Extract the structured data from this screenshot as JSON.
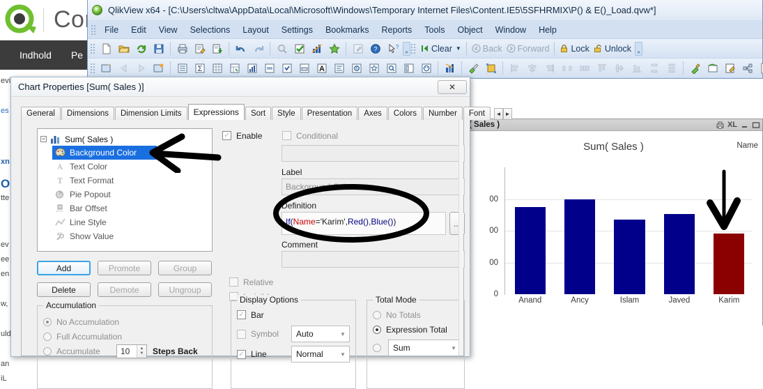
{
  "background_page": {
    "logo_icon": "qlik-q-logo",
    "brand": "Comm",
    "nav": [
      "Indhold",
      "Pe"
    ],
    "side_fragments": [
      "evi",
      "es",
      "xn",
      "O",
      "tte",
      "ev",
      "ee",
      "en",
      "w,",
      "uld",
      "an",
      "iL"
    ]
  },
  "qlikview": {
    "title": "QlikView x64 - [C:\\Users\\cltwa\\AppData\\Local\\Microsoft\\Windows\\Temporary Internet Files\\Content.IE5\\5SFHRMIX\\P() & E()_Load.qvw*]",
    "app_icon": "qlikview-globe-icon",
    "menu": [
      "File",
      "Edit",
      "View",
      "Selections",
      "Layout",
      "Settings",
      "Bookmarks",
      "Reports",
      "Tools",
      "Object",
      "Window",
      "Help"
    ],
    "toolbar1_icons": [
      "new-document-icon",
      "open-folder-icon",
      "reload-icon",
      "save-icon",
      "sep",
      "print-icon",
      "edit-script-icon",
      "load-data-icon",
      "sep",
      "undo-icon",
      "redo-icon",
      "sep",
      "search-icon",
      "select-all-icon",
      "chart-icon",
      "favorite-star-icon",
      "sep",
      "edit-module-icon",
      "help-icon",
      "context-help-icon"
    ],
    "toolbar1_buttons": [
      {
        "label": "Clear",
        "icon": "clear-icon",
        "dropdown": true,
        "enabled": true
      },
      {
        "label": "Back",
        "icon": "back-arrow-icon",
        "dropdown": false,
        "enabled": false
      },
      {
        "label": "Forward",
        "icon": "forward-arrow-icon",
        "dropdown": false,
        "enabled": false
      },
      {
        "label": "Lock",
        "icon": "lock-closed-icon",
        "dropdown": false,
        "enabled": true
      },
      {
        "label": "Unlock",
        "icon": "lock-open-icon",
        "dropdown": false,
        "enabled": true
      }
    ],
    "toolbar2_icons": [
      "new-sheet-icon",
      "previous-sheet-icon",
      "next-sheet-icon",
      "sheet-properties-icon",
      "sep",
      "list-box-icon",
      "statistics-box-icon",
      "table-box-icon",
      "pivot-table-icon",
      "chart-object-icon",
      "input-box-icon",
      "multi-box-icon",
      "current-selections-icon",
      "text-object-icon",
      "table-object-icon",
      "slider-object-icon",
      "bookmark-object-icon",
      "search-object-icon",
      "container-object-icon",
      "button-object-icon",
      "sep",
      "design-grid-icon",
      "sep",
      "paintbrush-icon",
      "fit-zoom-icon",
      "sep",
      "align-left-icon",
      "align-center-icon",
      "align-right-icon",
      "distribute-h-icon",
      "space-h-icon",
      "align-top-icon",
      "align-middle-icon",
      "align-bottom-icon",
      "distribute-v-icon",
      "space-v-icon",
      "sep",
      "promote-icon",
      "layout-icon",
      "edit-layout-icon",
      "share-icon",
      "publish-icon"
    ],
    "overflow_glyph": "»"
  },
  "chart_object": {
    "caption_title": "( Sales )",
    "caption_buttons": [
      "print-icon",
      "XL",
      "minimize-icon",
      "maximize-icon"
    ]
  },
  "chart_data": {
    "type": "bar",
    "title": "Sum( Sales )",
    "xlabel": "Name",
    "ylabel": "",
    "categories": [
      "Anand",
      "Ancy",
      "Islam",
      "Javed",
      "Karim"
    ],
    "values": [
      1370,
      1495,
      1180,
      1265,
      955
    ],
    "ylim": [
      0,
      2000
    ],
    "yticks": [
      0,
      500,
      1000,
      1500
    ],
    "ytick_labels": [
      "0",
      "00",
      "00",
      "00"
    ],
    "grid": true,
    "legend": "none",
    "bar_colors": [
      "#00008b",
      "#00008b",
      "#00008b",
      "#00008b",
      "#8b0000"
    ],
    "series": [
      {
        "name": "Sum( Sales )",
        "values": [
          1370,
          1495,
          1180,
          1265,
          955
        ]
      }
    ],
    "annotations": [
      "black down-arrow pointing at Karim bar"
    ]
  },
  "dialog": {
    "title": "Chart Properties [Sum( Sales )]",
    "close_label": "✕",
    "tabs": [
      "General",
      "Dimensions",
      "Dimension Limits",
      "Expressions",
      "Sort",
      "Style",
      "Presentation",
      "Axes",
      "Colors",
      "Number",
      "Font"
    ],
    "active_tab": "Expressions",
    "tab_scroll_left": "◄",
    "tab_scroll_right": "►",
    "tree": {
      "root": {
        "label": "Sum( Sales )",
        "icon": "bar-chart-icon",
        "expander": "−"
      },
      "items": [
        {
          "label": "Background Color",
          "icon": "palette-icon",
          "selected": true
        },
        {
          "label": "Text Color",
          "icon": "text-color-icon",
          "selected": false
        },
        {
          "label": "Text Format",
          "icon": "text-format-icon",
          "selected": false
        },
        {
          "label": "Pie Popout",
          "icon": "pie-chart-icon",
          "selected": false
        },
        {
          "label": "Bar Offset",
          "icon": "bar-offset-icon",
          "selected": false
        },
        {
          "label": "Line Style",
          "icon": "line-style-icon",
          "selected": false
        },
        {
          "label": "Show Value",
          "icon": "show-value-icon",
          "selected": false
        }
      ]
    },
    "buttons": [
      {
        "label": "Add",
        "enabled": true,
        "primary": true
      },
      {
        "label": "Promote",
        "enabled": false,
        "primary": false
      },
      {
        "label": "Group",
        "enabled": false,
        "primary": false
      },
      {
        "label": "Delete",
        "enabled": true,
        "primary": false
      },
      {
        "label": "Demote",
        "enabled": false,
        "primary": false
      },
      {
        "label": "Ungroup",
        "enabled": false,
        "primary": false
      }
    ],
    "accumulation": {
      "legend": "Accumulation",
      "options": [
        "No Accumulation",
        "Full Accumulation",
        "Accumulate"
      ],
      "selected": "No Accumulation",
      "steps_value": "10",
      "steps_label": "Steps Back"
    },
    "enable_checkbox": {
      "label": "Enable",
      "checked": true
    },
    "conditional_checkbox": {
      "label": "Conditional",
      "checked": false
    },
    "conditional_value": "",
    "label_field": {
      "caption": "Label",
      "value": "Background Color"
    },
    "definition_field": {
      "caption": "Definition",
      "ellipsis": "...",
      "tokens": [
        {
          "t": "If(",
          "c": "#000080"
        },
        {
          "t": " Name",
          "c": "#cc0000"
        },
        {
          "t": " = ",
          "c": "#202020"
        },
        {
          "t": "'Karim'",
          "c": "#202020"
        },
        {
          "t": ", ",
          "c": "#202020"
        },
        {
          "t": "Red()",
          "c": "#000080"
        },
        {
          "t": ", ",
          "c": "#202020"
        },
        {
          "t": "Blue()",
          "c": "#000080"
        },
        {
          "t": " )",
          "c": "#202020"
        }
      ],
      "plain": "If( Name = 'Karim', Red(), Blue() )"
    },
    "comment_field": {
      "caption": "Comment",
      "value": ""
    },
    "relative_checkbox": {
      "label": "Relative",
      "checked": false
    },
    "invisible_checkbox": {
      "label": "Invisible",
      "checked": false
    },
    "display_options": {
      "legend": "Display Options",
      "items": [
        {
          "label": "Bar",
          "checked": true,
          "combo": null
        },
        {
          "label": "Symbol",
          "checked": false,
          "combo": "Auto"
        },
        {
          "label": "Line",
          "checked": true,
          "combo": "Normal"
        }
      ]
    },
    "total_mode": {
      "legend": "Total Mode",
      "options": [
        "No Totals",
        "Expression Total"
      ],
      "selected": "Expression Total",
      "aggregation_combo": "Sum"
    }
  },
  "annotations": {
    "tree_arrow": "hand-drawn-arrow-pointing-left-at-background-color",
    "definition_circle": "hand-drawn-ellipse-around-definition-expression",
    "chart_arrow": "hand-drawn-down-arrow-pointing-at-karim-bar"
  }
}
